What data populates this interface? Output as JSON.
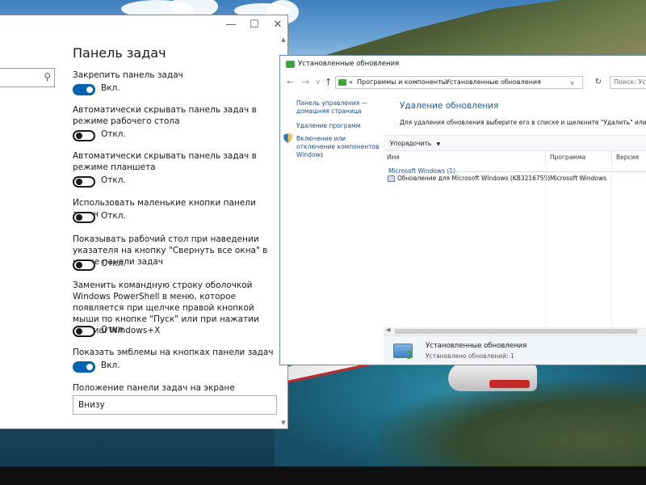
{
  "settings_window": {
    "title": "Панель задач",
    "search": {
      "placeholder": "",
      "icon": "search-icon"
    },
    "window_controls": {
      "minimize": "—",
      "maximize": "☐",
      "close": "✕"
    },
    "options": [
      {
        "label": "Закрепить панель задач",
        "state": "Вкл.",
        "on": true
      },
      {
        "label": "Автоматически скрывать панель задач в режиме рабочего стола",
        "state": "Откл.",
        "on": false
      },
      {
        "label": "Автоматически скрывать панель задач в режиме планшета",
        "state": "Откл.",
        "on": false
      },
      {
        "label": "Использовать маленькие кнопки панели задач",
        "state": "Откл.",
        "on": false
      },
      {
        "label": "Показывать рабочий стол при наведении указателя на кнопку \"Свернуть все окна\" в конце панели задач",
        "state": "Откл.",
        "on": false
      },
      {
        "label": "Заменить командную строку оболочкой Windows PowerShell в меню, которое появляется при щелчке правой кнопкой мыши по кнопке \"Пуск\" или при нажатии клавиш Windows+X",
        "state": "Откл.",
        "on": false
      },
      {
        "label": "Показать эмблемы на кнопках панели задач",
        "state": "Вкл.",
        "on": true
      }
    ],
    "position": {
      "label": "Положение панели задач на экране",
      "value": "Внизу"
    }
  },
  "control_panel": {
    "title": "Установленные обновления",
    "address": {
      "prefix": "«",
      "parts": [
        "Программы и компоненты",
        "Установленные обновления"
      ]
    },
    "search_placeholder": "Поиск: Уста",
    "left_links": [
      "Панель управления — домашняя страница",
      "Удаление программ",
      "Включение или отключение компонентов Windows"
    ],
    "heading": "Удаление обновления",
    "description": "Для удаления обновления выберите его в списке и щелкните \"Удалить\" или \"Изменить\".",
    "toolbar": {
      "organize": "Упорядочить",
      "organize_arrow": "▼"
    },
    "columns": [
      "Имя",
      "Программа",
      "Версия"
    ],
    "group": "Microsoft Windows (1)",
    "rows": [
      {
        "name": "Обновление для Microsoft Windows (KB3216755)",
        "program": "Microsoft Windows",
        "version": ""
      }
    ],
    "details": {
      "title": "Установленные обновления",
      "subtitle": "Установлено обновлений: 1"
    }
  },
  "colors": {
    "accent": "#0063b1",
    "link": "#1a4c99",
    "heading": "#1f5a99",
    "group": "#1e50a0"
  }
}
